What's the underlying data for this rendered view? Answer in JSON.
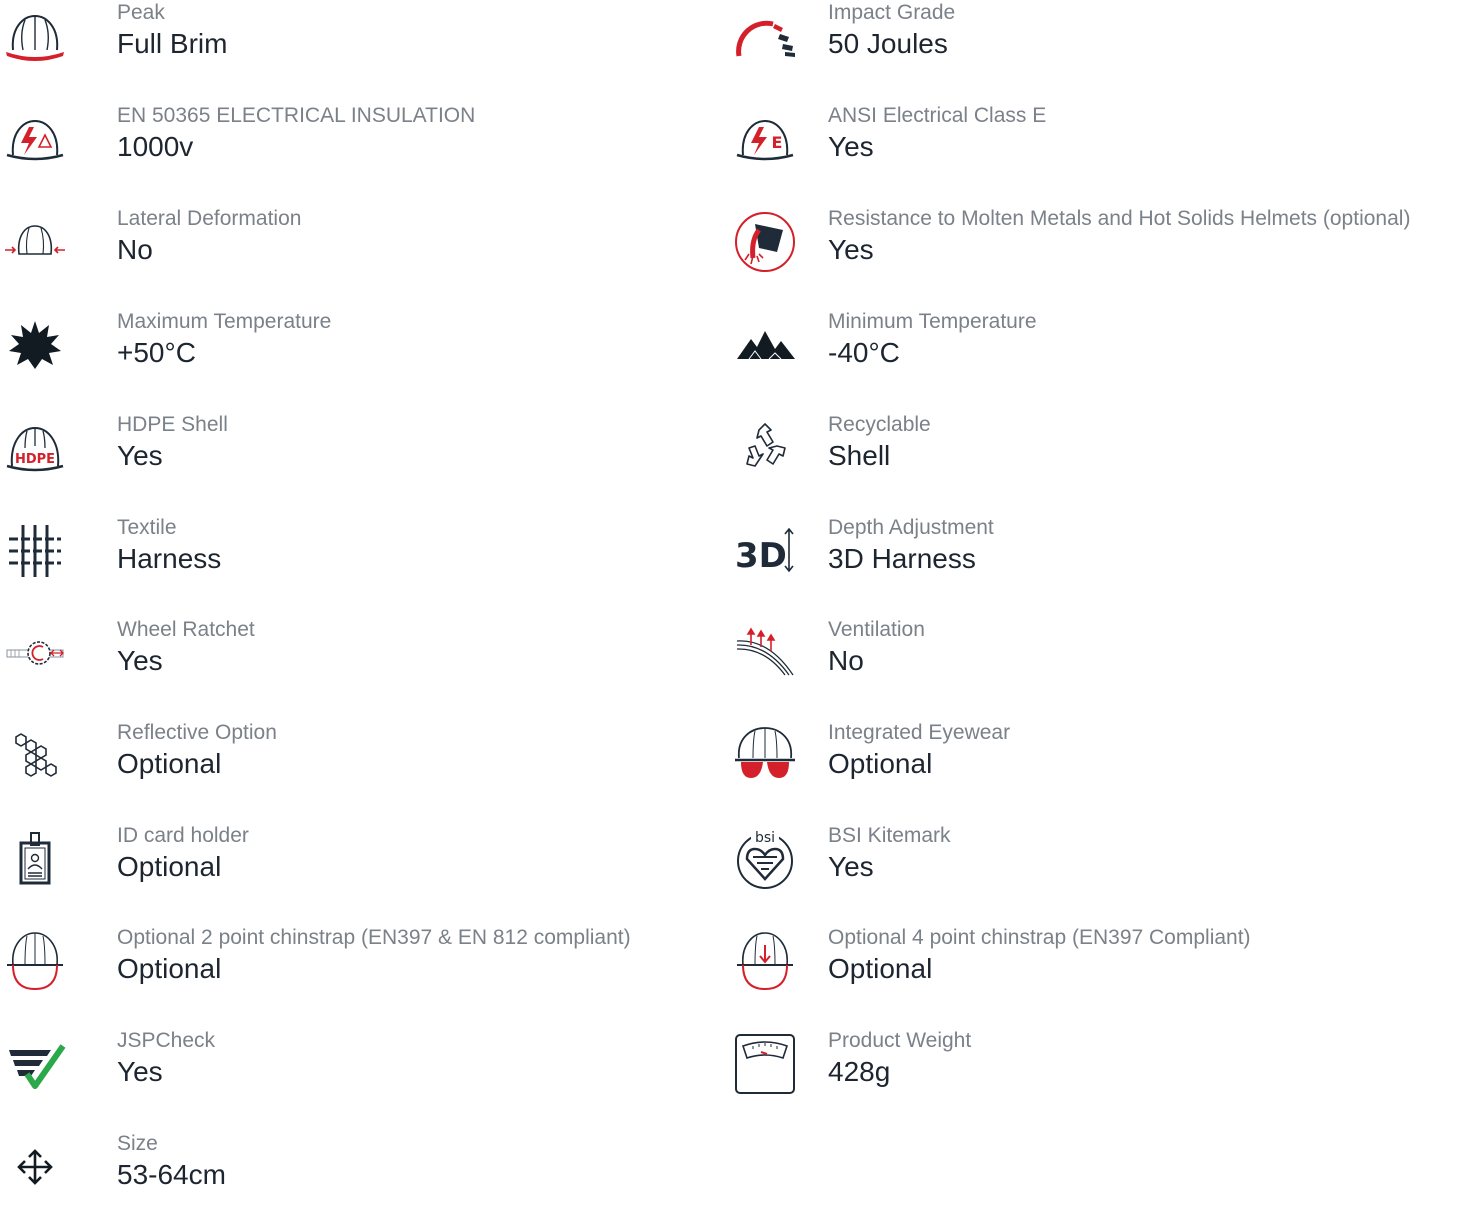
{
  "colors": {
    "label": "#7b8189",
    "value": "#1d2630",
    "icon_dark": "#1f2b38",
    "accent_red": "#d4202a",
    "accent_green": "#2aa84a"
  },
  "left": [
    {
      "icon": "helmet-peak-icon",
      "label": "Peak",
      "value": "Full Brim"
    },
    {
      "icon": "electrical-insulation-icon",
      "label": "EN 50365 ELECTRICAL INSULATION",
      "value": "1000v"
    },
    {
      "icon": "lateral-deformation-icon",
      "label": "Lateral Deformation",
      "value": "No"
    },
    {
      "icon": "sun-icon",
      "label": "Maximum Temperature",
      "value": "+50°C"
    },
    {
      "icon": "hdpe-shell-icon",
      "label": "HDPE Shell",
      "value": "Yes"
    },
    {
      "icon": "textile-icon",
      "label": "Textile",
      "value": "Harness"
    },
    {
      "icon": "wheel-ratchet-icon",
      "label": "Wheel Ratchet",
      "value": "Yes"
    },
    {
      "icon": "reflective-icon",
      "label": "Reflective Option",
      "value": "Optional"
    },
    {
      "icon": "id-card-icon",
      "label": "ID card holder",
      "value": "Optional"
    },
    {
      "icon": "chinstrap-2pt-icon",
      "label": "Optional 2 point chinstrap (EN397 & EN 812 compliant)",
      "value": "Optional"
    },
    {
      "icon": "jspcheck-icon",
      "label": "JSPCheck",
      "value": "Yes"
    },
    {
      "icon": "size-arrows-icon",
      "label": "Size",
      "value": "53-64cm"
    }
  ],
  "right": [
    {
      "icon": "impact-gauge-icon",
      "label": "Impact Grade",
      "value": "50 Joules"
    },
    {
      "icon": "ansi-class-e-icon",
      "label": "ANSI Electrical Class E",
      "value": "Yes"
    },
    {
      "icon": "molten-metal-icon",
      "label": "Resistance to Molten Metals and Hot Solids Helmets (optional)",
      "value": "Yes"
    },
    {
      "icon": "mountain-icon",
      "label": "Minimum Temperature",
      "value": "-40°C"
    },
    {
      "icon": "recycle-icon",
      "label": "Recyclable",
      "value": "Shell"
    },
    {
      "icon": "depth-3d-icon",
      "label": "Depth Adjustment",
      "value": "3D Harness"
    },
    {
      "icon": "ventilation-icon",
      "label": "Ventilation",
      "value": "No"
    },
    {
      "icon": "eyewear-icon",
      "label": "Integrated Eyewear",
      "value": "Optional"
    },
    {
      "icon": "bsi-kitemark-icon",
      "label": "BSI Kitemark",
      "value": "Yes"
    },
    {
      "icon": "chinstrap-4pt-icon",
      "label": "Optional 4 point chinstrap (EN397 Compliant)",
      "value": "Optional"
    },
    {
      "icon": "scale-icon",
      "label": "Product Weight",
      "value": "428g"
    }
  ]
}
